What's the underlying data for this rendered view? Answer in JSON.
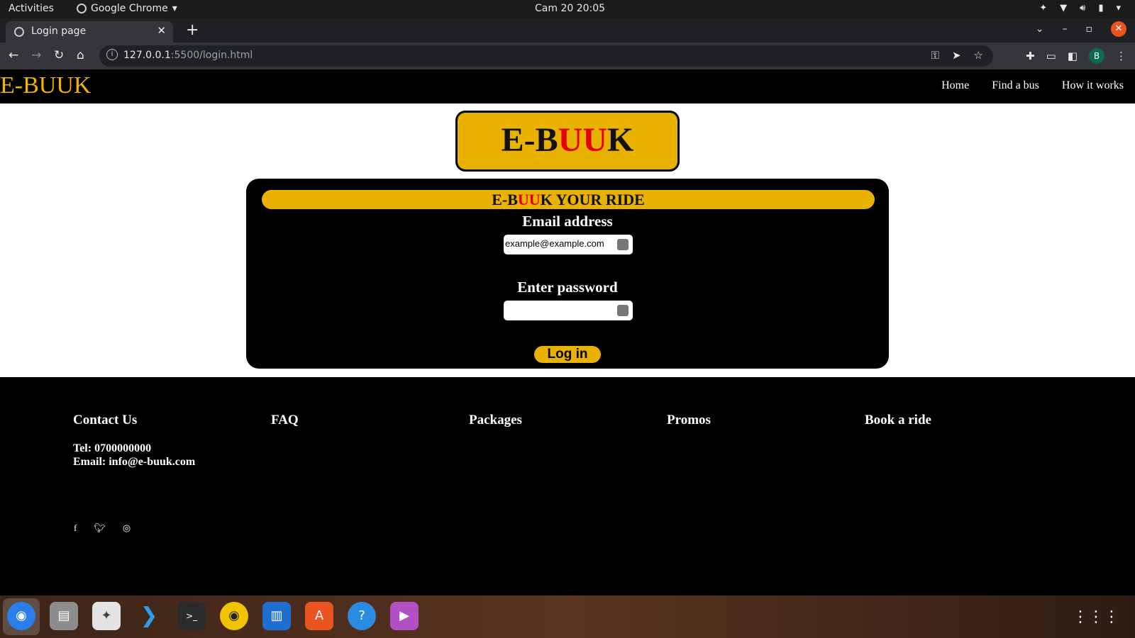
{
  "system": {
    "activities": "Activities",
    "app_name": "Google Chrome",
    "clock": "Cam 20  20:05"
  },
  "browser": {
    "tab_title": "Login page",
    "url_host": "127.0.0.1",
    "url_path": ":5500/login.html",
    "profile_initial": "B"
  },
  "nav": {
    "brand": "E-BUUK",
    "links": [
      "Home",
      "Find a bus",
      "How it works"
    ]
  },
  "logo": {
    "prefix": "E-B",
    "highlight": "UU",
    "suffix": "K"
  },
  "login": {
    "banner_prefix": "E-B",
    "banner_highlight": "UU",
    "banner_suffix": "K YOUR RIDE",
    "email_label": "Email address",
    "email_value": "example@example.com",
    "password_label": "Enter password",
    "password_value": "",
    "submit_label": "Log in"
  },
  "footer": {
    "columns": [
      "Contact Us",
      "FAQ",
      "Packages",
      "Promos",
      "Book a ride"
    ],
    "tel": "Tel: 0700000000",
    "email": "Email: info@e-buuk.com",
    "social": [
      "facebook-icon",
      "twitter-icon",
      "instagram-icon"
    ]
  },
  "colors": {
    "accent": "#eab200",
    "highlight": "#e60000",
    "brand_nav": "#f0b400"
  }
}
